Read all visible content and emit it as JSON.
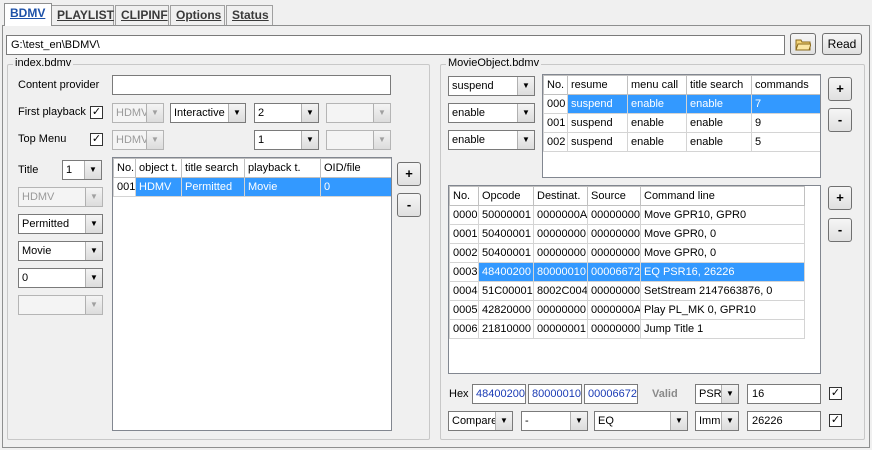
{
  "tabs": [
    "BDMV",
    "PLAYLIST",
    "CLIPINF",
    "Options",
    "Status"
  ],
  "path": {
    "value": "G:\\test_en\\BDMV\\",
    "read_label": "Read"
  },
  "index": {
    "title": "index.bdmv",
    "content_provider_label": "Content provider",
    "content_provider_value": "",
    "first_playback_label": "First playback",
    "first_playback_checked": "✓",
    "fp_type": "HDMV",
    "fp_mode": "Interactive",
    "fp_num": "2",
    "fp_extra": "",
    "top_menu_label": "Top Menu",
    "top_menu_checked": "✓",
    "tm_type": "HDMV",
    "tm_num": "1",
    "tm_extra": "",
    "title_label": "Title",
    "title_num": "1",
    "t_type": "HDMV",
    "t_search": "Permitted",
    "t_playback": "Movie",
    "t_zero": "0",
    "t_extra": "",
    "table": {
      "columns": [
        "No.",
        "object t.",
        "title search",
        "playback t.",
        "OID/file"
      ],
      "rows": [
        [
          "001",
          "HDMV",
          "Permitted",
          "Movie",
          "0"
        ]
      ]
    },
    "plus": "+",
    "minus": "-"
  },
  "movieobject": {
    "title": "MovieObject.bdmv",
    "resume": "suspend",
    "menu_call": "enable",
    "title_search": "enable",
    "objects": {
      "columns": [
        "No.",
        "resume",
        "menu call",
        "title search",
        "commands"
      ],
      "rows": [
        [
          "000",
          "suspend",
          "enable",
          "enable",
          "7"
        ],
        [
          "001",
          "suspend",
          "enable",
          "enable",
          "9"
        ],
        [
          "002",
          "suspend",
          "enable",
          "enable",
          "5"
        ]
      ]
    },
    "commands": {
      "columns": [
        "No.",
        "Opcode",
        "Destinat.",
        "Source",
        "Command line"
      ],
      "rows": [
        [
          "0000",
          "50000001",
          "0000000A",
          "00000000",
          "Move GPR10, GPR0"
        ],
        [
          "0001",
          "50400001",
          "00000000",
          "00000000",
          "Move GPR0, 0"
        ],
        [
          "0002",
          "50400001",
          "00000000",
          "00000000",
          "Move GPR0, 0"
        ],
        [
          "0003",
          "48400200",
          "80000010",
          "00006672",
          "EQ PSR16, 26226"
        ],
        [
          "0004",
          "51C00001",
          "8002C004",
          "00000000",
          "SetStream 2147663876, 0"
        ],
        [
          "0005",
          "42820000",
          "00000000",
          "0000000A",
          "Play PL_MK 0, GPR10"
        ],
        [
          "0006",
          "21810000",
          "00000001",
          "00000000",
          "Jump Title 1"
        ]
      ]
    },
    "hex_label": "Hex",
    "hex1": "48400200",
    "hex2": "80000010",
    "hex3": "00006672",
    "valid_label": "Valid",
    "dest_type": "PSR",
    "dest_value": "16",
    "dest_checked": "✓",
    "cmd_group": "Compare",
    "cmd_sub": "-",
    "cmd_op": "EQ",
    "src_type": "Imm",
    "src_value": "26226",
    "src_checked": "✓",
    "plus": "+",
    "minus": "-"
  }
}
